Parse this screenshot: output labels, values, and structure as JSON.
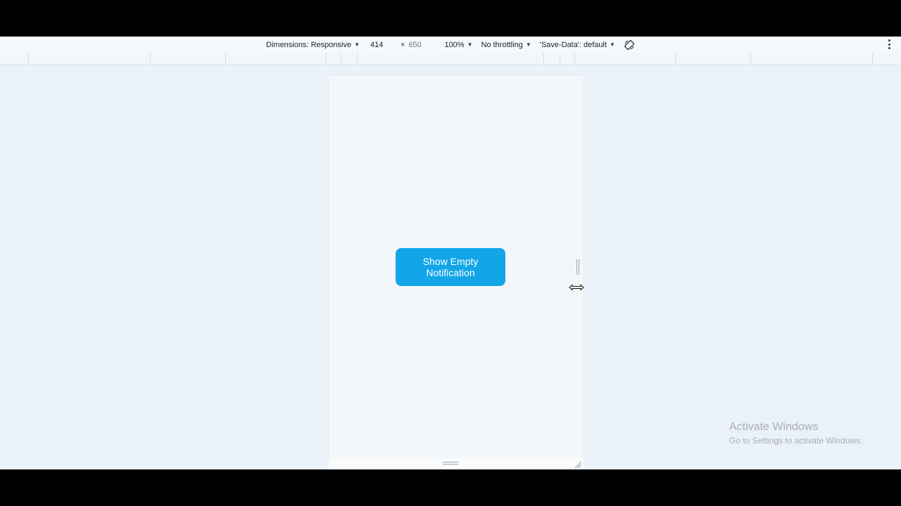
{
  "device_toolbar": {
    "dimensions_label": "Dimensions: Responsive",
    "width_value": "414",
    "times_symbol": "×",
    "height_placeholder": "650",
    "zoom_label": "100%",
    "throttling_label": "No throttling",
    "save_data_label": "'Save-Data': default"
  },
  "viewport": {
    "button_label": "Show Empty Notification",
    "button_color": "#12a6e8",
    "background_color": "#f4f7f9"
  },
  "watermark": {
    "title": "Activate Windows",
    "subtitle": "Go to Settings to activate Windows."
  }
}
